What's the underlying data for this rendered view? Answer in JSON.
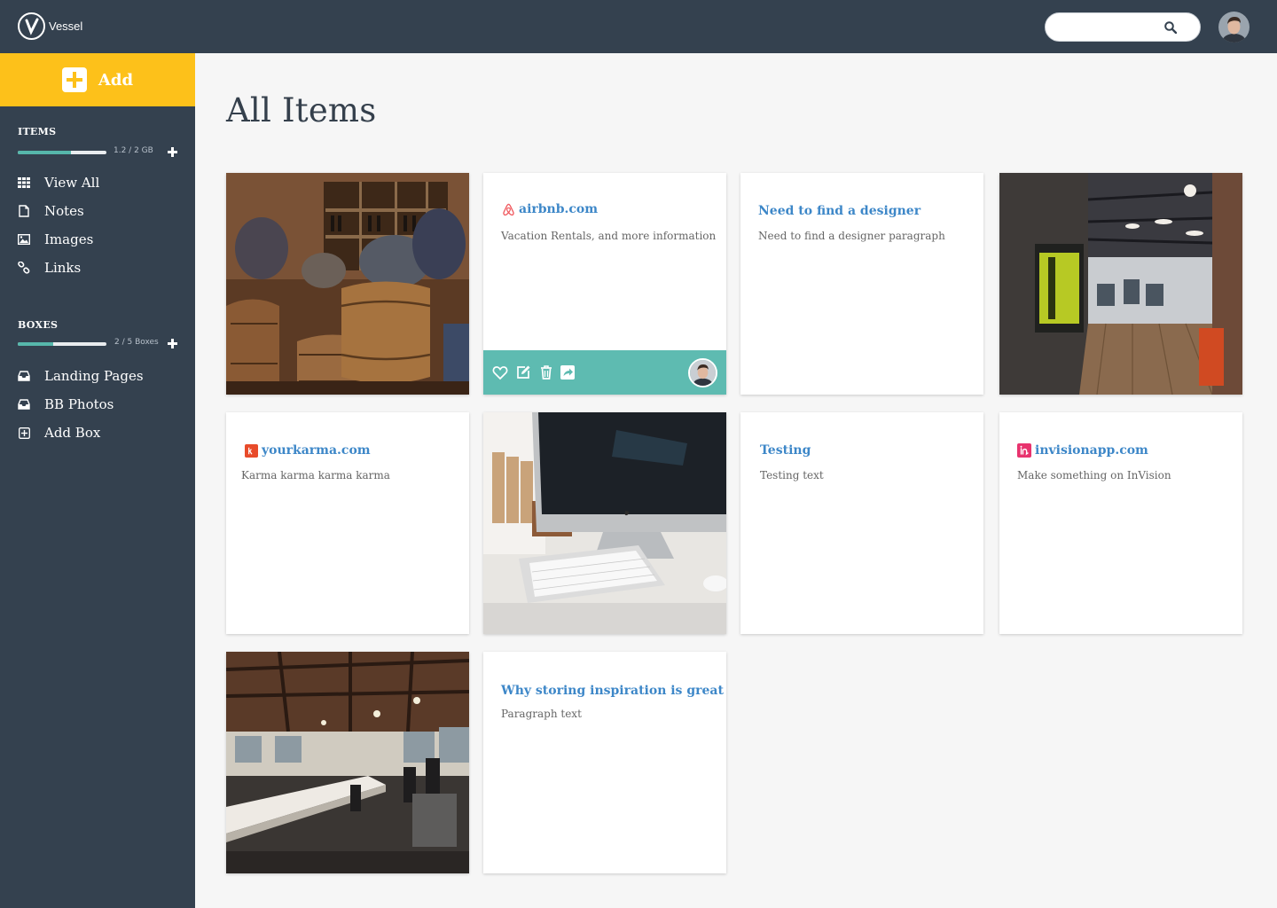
{
  "app": {
    "name": "Vessel"
  },
  "colors": {
    "topbar": "#34414f",
    "sidebar": "#34414f",
    "accent": "#fdc11a",
    "teal": "#5ebbb1",
    "link": "#3d87c8"
  },
  "search": {
    "placeholder": ""
  },
  "sidebar": {
    "add_label": "Add",
    "items": {
      "title": "ITEMS",
      "usage": "1.2 / 2 GB",
      "fill": 0.6,
      "nav": [
        {
          "label": "View All",
          "icon": "grid-icon"
        },
        {
          "label": "Notes",
          "icon": "note-icon"
        },
        {
          "label": "Images",
          "icon": "image-icon"
        },
        {
          "label": "Links",
          "icon": "link-icon"
        }
      ]
    },
    "boxes": {
      "title": "BOXES",
      "usage": "2 / 5 Boxes",
      "fill": 0.4,
      "nav": [
        {
          "label": "Landing Pages",
          "icon": "inbox-icon"
        },
        {
          "label": "BB Photos",
          "icon": "inbox-icon"
        },
        {
          "label": "Add Box",
          "icon": "add-box-icon"
        }
      ]
    }
  },
  "main": {
    "title": "All Items",
    "cards": [
      {
        "type": "image",
        "image": "bar-photo"
      },
      {
        "type": "link",
        "site": "airbnb",
        "title": "airbnb.com",
        "text": "Vacation Rentals, and more information",
        "hover": true
      },
      {
        "type": "note",
        "title": "Need to find a designer",
        "text": "Need to find a designer paragraph"
      },
      {
        "type": "image",
        "image": "office-hall-photo"
      },
      {
        "type": "link",
        "site": "yourkarma",
        "title": "yourkarma.com",
        "text": "Karma karma karma karma"
      },
      {
        "type": "image",
        "image": "imac-desk-photo"
      },
      {
        "type": "note",
        "title": "Testing",
        "text": "Testing text"
      },
      {
        "type": "link",
        "site": "invision",
        "title": "invisionapp.com",
        "text": "Make something on InVision"
      },
      {
        "type": "image",
        "image": "open-office-photo"
      },
      {
        "type": "note",
        "title": "Why storing inspiration is great",
        "text": "Paragraph text"
      }
    ]
  }
}
